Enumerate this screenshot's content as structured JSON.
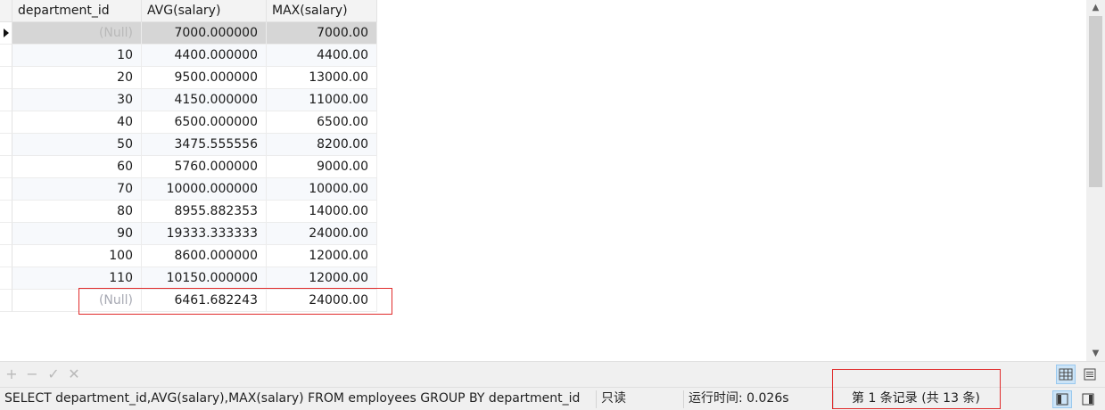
{
  "grid": {
    "columns": [
      "department_id",
      "AVG(salary)",
      "MAX(salary)"
    ],
    "rows": [
      {
        "department_id": "(Null)",
        "avg": "7000.000000",
        "max": "7000.00"
      },
      {
        "department_id": "10",
        "avg": "4400.000000",
        "max": "4400.00"
      },
      {
        "department_id": "20",
        "avg": "9500.000000",
        "max": "13000.00"
      },
      {
        "department_id": "30",
        "avg": "4150.000000",
        "max": "11000.00"
      },
      {
        "department_id": "40",
        "avg": "6500.000000",
        "max": "6500.00"
      },
      {
        "department_id": "50",
        "avg": "3475.555556",
        "max": "8200.00"
      },
      {
        "department_id": "60",
        "avg": "5760.000000",
        "max": "9000.00"
      },
      {
        "department_id": "70",
        "avg": "10000.000000",
        "max": "10000.00"
      },
      {
        "department_id": "80",
        "avg": "8955.882353",
        "max": "14000.00"
      },
      {
        "department_id": "90",
        "avg": "19333.333333",
        "max": "24000.00"
      },
      {
        "department_id": "100",
        "avg": "8600.000000",
        "max": "12000.00"
      },
      {
        "department_id": "110",
        "avg": "10150.000000",
        "max": "12000.00"
      },
      {
        "department_id": "(Null)",
        "avg": "6461.682243",
        "max": "24000.00"
      }
    ],
    "null_text": "(Null)",
    "selected_row": 0
  },
  "toolbar": {
    "add_icon": "plus-icon",
    "remove_icon": "minus-icon",
    "apply_icon": "check-icon",
    "discard_icon": "x-icon",
    "grid_view_icon": "grid-view-icon",
    "form_view_icon": "form-view-icon"
  },
  "status": {
    "sql": "SELECT department_id,AVG(salary),MAX(salary) FROM employees GROUP BY department_id",
    "mode": "只读",
    "runtime": "运行时间: 0.026s",
    "record": "第 1 条记录  (共 13 条)"
  },
  "colors": {
    "highlight_box": "#e02b2b",
    "selected_row": "#d6d6d6",
    "null_text": "#a7a9b3",
    "active_button": "#cce4f7"
  }
}
